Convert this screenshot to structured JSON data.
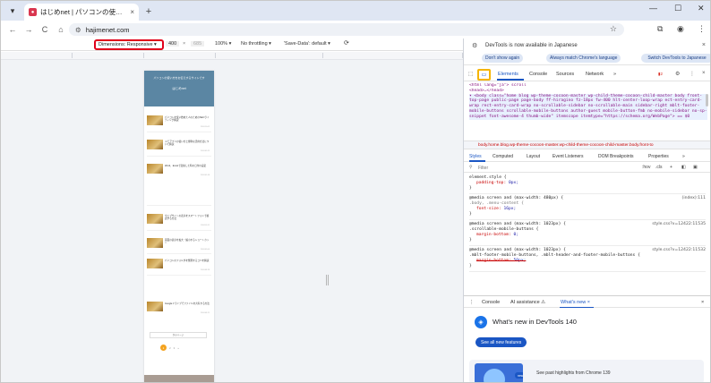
{
  "window": {
    "tab_menu_icon": "chevron-down",
    "tab_title": "はじめnet | パソコンの使い方をお伝えする",
    "tab_close": "×",
    "new_tab": "+",
    "minimize": "—",
    "maximize": "☐",
    "close": "✕"
  },
  "address_bar": {
    "url": "hajimenet.com",
    "back": "←",
    "forward": "→",
    "reload": "C",
    "home": "⌂",
    "site_info": "⚙",
    "bookmark": "☆",
    "extensions": "⧉",
    "profile": "◉",
    "menu": "⋮"
  },
  "device_toolbar": {
    "dimensions_label": "Dimensions: Responsive ▾",
    "width": "400",
    "times": "×",
    "height": "685",
    "zoom": "100% ▾",
    "throttling": "No throttling ▾",
    "save_data": "'Save-Data': default ▾",
    "rotate_icon": "rotate-icon"
  },
  "page_preview": {
    "header_text": "パソコンの使い方をお伝えするサイトです",
    "logo_text": "はじめnet",
    "posts": [
      {
        "title": "パソコンを使い始めた人のためのSEOライティング解説",
        "date": "2024.10.02"
      },
      {
        "title": "メモアプリの使い方と便利な活用方法について解説",
        "date": "2024.09.25"
      },
      {
        "title": "Word、Excelで変換した時の日付の設定",
        "date": "2024.09.18"
      },
      {
        "title": "ウェブサイトの表示をスマートフォンで確認する方法",
        "date": "2024.09.11"
      },
      {
        "title": "画面の表示を拡大・縮小するショートカット",
        "date": "2024.09.04"
      },
      {
        "title": "パソコンのフォルダを整理するコツを解説",
        "date": "2024.08.28"
      },
      {
        "title": "Googleドライブでファイルを共有する方法",
        "date": "2024.08.21"
      }
    ],
    "more_label": "次のページ",
    "pager": [
      "1",
      "2",
      "3",
      "»"
    ]
  },
  "devtools": {
    "info_message": "DevTools is now available in Japanese",
    "dont_show": "Don't show again",
    "match_language": "Always match Chrome's language",
    "switch_japanese": "Switch DevTools to Japanese",
    "tabs": [
      "Elements",
      "Console",
      "Sources",
      "Network",
      "»"
    ],
    "issues_badge": "2",
    "elements_lines": [
      "<html lang=\"ja\"> scroll",
      "  <head>…</head>",
      "▾ <body class=\"home blog wp-theme-cocoon-master wp-child-theme-cocoon-child-master body front-top-page public-page page-body ff-hiragino fz-18px fw-400 hlt-center-loop-wrap ect-entry-card-wrap rect-entry-card-wrap no-scrollable-sidebar no-scrollable-main sidebar-right mblt-footer-mobile-buttons scrollable-mobile-buttons author-guest mobile-button-fmb no-mobile-sidebar no-sp-snippet font-awesome-4 thumb-wide\" itemscope itemtype=\"https://schema.org/WebPage\"> == $0"
    ],
    "breadcrumb": "body.home.blog.wp-theme-cocoon-master.wp-child-theme-cocoon-child-master.body.front-to",
    "styles_tabs": [
      "Styles",
      "Computed",
      "Layout",
      "Event Listeners",
      "DOM Breakpoints",
      "Properties",
      "»"
    ],
    "filter_placeholder": "Filter",
    "filter_hov": ":hov",
    "filter_cls": ".cls",
    "rules": [
      {
        "selector": "element.style {",
        "props": [
          [
            "padding-top",
            "0px;"
          ]
        ],
        "close": "}",
        "source": "",
        "strike": false
      },
      {
        "selector": "@media screen and (max-width: 480px) {",
        "sub": ".body, .menu-content {",
        "props": [
          [
            "font-size",
            "16px;"
          ]
        ],
        "close": "}",
        "source": "(index):111",
        "strike": false
      },
      {
        "selector": "@media screen and (max-width: 1023px) {",
        "sub": ".scrollable-mobile-buttons {",
        "props": [
          [
            "margin-bottom",
            "0;"
          ]
        ],
        "close": "}",
        "source": "style.css?v=12422:11535",
        "strike": false
      },
      {
        "selector": "@media screen and (max-width: 1023px) {",
        "sub": ".mblt-footer-mobile-buttons, .mblt-header-and-footer-mobile-buttons {",
        "props": [
          [
            "margin-bottom",
            "50px;"
          ]
        ],
        "close": "}",
        "source": "style.css?v=12422:11532",
        "strike": true
      }
    ],
    "drawer_tabs": [
      "Console",
      "AI assistance ⚠",
      "What's new ×"
    ],
    "whats_new_title": "What's new in DevTools 140",
    "see_all": "See all new features",
    "new_badge": "new",
    "highlight_text": "See past highlights from Chrome 139"
  },
  "colors": {
    "highlight_red": "#e0001a",
    "highlight_yellow": "#f5b400",
    "accent_blue": "#1a56c4"
  }
}
